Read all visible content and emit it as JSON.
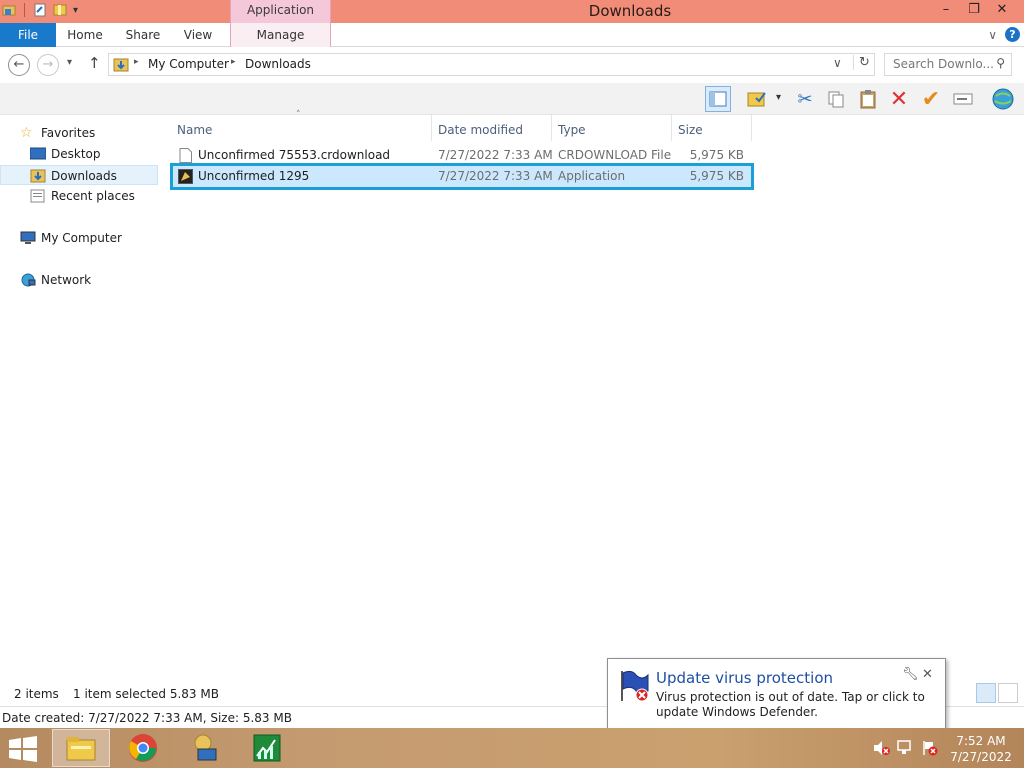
{
  "window": {
    "title": "Downloads",
    "context_tab": "Application Tools",
    "minimize": "–",
    "maximize": "❐",
    "close": "✕"
  },
  "ribbon": {
    "tabs": [
      "File",
      "Home",
      "Share",
      "View",
      "Manage"
    ],
    "collapse_glyph": "∨",
    "help_glyph": "?"
  },
  "address": {
    "path": [
      "My Computer",
      "Downloads"
    ],
    "search_placeholder": "Search Downlo..."
  },
  "nav": {
    "favorites": "Favorites",
    "desktop": "Desktop",
    "downloads": "Downloads",
    "recent": "Recent places",
    "computer": "My Computer",
    "network": "Network"
  },
  "columns": [
    "Name",
    "Date modified",
    "Type",
    "Size"
  ],
  "files": [
    {
      "name": "Unconfirmed 75553.crdownload",
      "date": "7/27/2022 7:33 AM",
      "type": "CRDOWNLOAD File",
      "size": "5,975 KB"
    },
    {
      "name": "Unconfirmed 1295",
      "date": "7/27/2022 7:33 AM",
      "type": "Application",
      "size": "5,975 KB"
    }
  ],
  "status": {
    "items": "2 items",
    "selected": "1 item selected  5.83 MB",
    "details": "Date created: 7/27/2022 7:33 AM, Size: 5.83 MB"
  },
  "toast": {
    "title": "Update virus protection",
    "message": "Virus protection is out of date. Tap or click to update Windows Defender."
  },
  "clock": {
    "time": "7:52 AM",
    "date": "7/27/2022"
  },
  "colors": {
    "titlebar": "#f08c77",
    "file_tab": "#1979ca",
    "selection_outline": "#19a0d8",
    "selection_fill": "#cce8ff"
  }
}
